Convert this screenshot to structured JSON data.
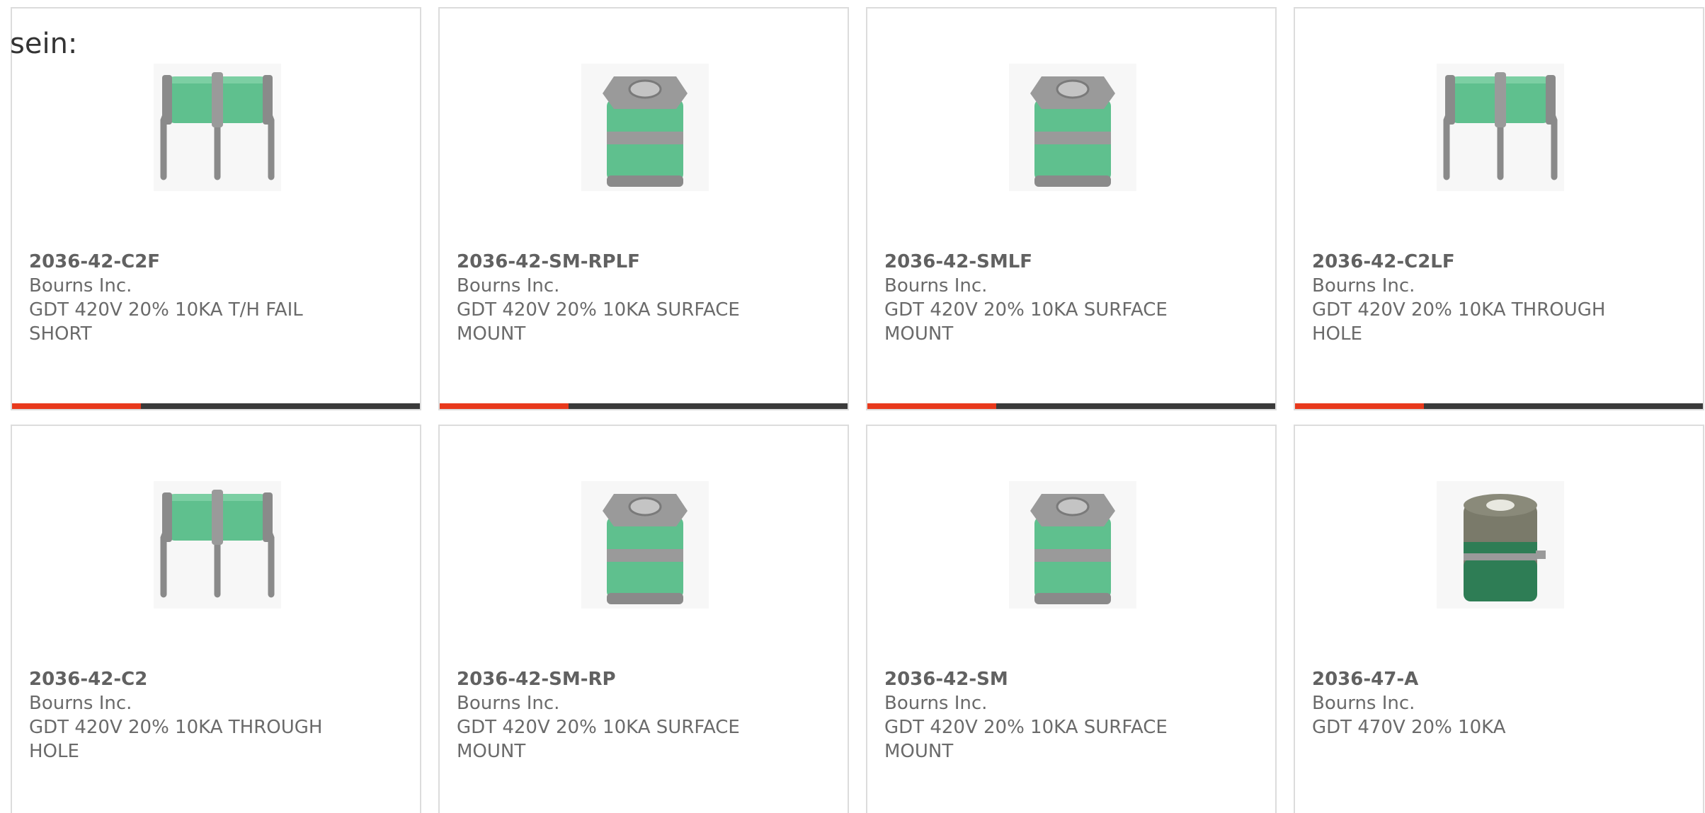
{
  "intro_text": "sein:",
  "colors": {
    "accent": "#e8391c",
    "bar": "#3a3a3a",
    "gdt_green": "#5fc08e",
    "gdt_dark_green": "#2e7d55",
    "metal": "#8a8a8a"
  },
  "products": [
    {
      "part_number": "2036-42-C2F",
      "manufacturer": "Bourns Inc.",
      "description": "GDT 420V 20% 10KA T/H FAIL SHORT",
      "image_icon": "three-lead-gdt-icon"
    },
    {
      "part_number": "2036-42-SM-RPLF",
      "manufacturer": "Bourns Inc.",
      "description": "GDT 420V 20% 10KA SURFACE MOUNT",
      "image_icon": "surface-mount-gdt-icon"
    },
    {
      "part_number": "2036-42-SMLF",
      "manufacturer": "Bourns Inc.",
      "description": "GDT 420V 20% 10KA SURFACE MOUNT",
      "image_icon": "surface-mount-gdt-icon"
    },
    {
      "part_number": "2036-42-C2LF",
      "manufacturer": "Bourns Inc.",
      "description": "GDT 420V 20% 10KA THROUGH HOLE",
      "image_icon": "three-lead-gdt-icon"
    },
    {
      "part_number": "2036-42-C2",
      "manufacturer": "Bourns Inc.",
      "description": "GDT 420V 20% 10KA THROUGH HOLE",
      "image_icon": "three-lead-gdt-icon"
    },
    {
      "part_number": "2036-42-SM-RP",
      "manufacturer": "Bourns Inc.",
      "description": "GDT 420V 20% 10KA SURFACE MOUNT",
      "image_icon": "surface-mount-gdt-icon"
    },
    {
      "part_number": "2036-42-SM",
      "manufacturer": "Bourns Inc.",
      "description": "GDT 420V 20% 10KA SURFACE MOUNT",
      "image_icon": "surface-mount-gdt-icon"
    },
    {
      "part_number": "2036-47-A",
      "manufacturer": "Bourns Inc.",
      "description": "GDT 470V 20% 10KA",
      "image_icon": "compact-gdt-icon"
    }
  ]
}
